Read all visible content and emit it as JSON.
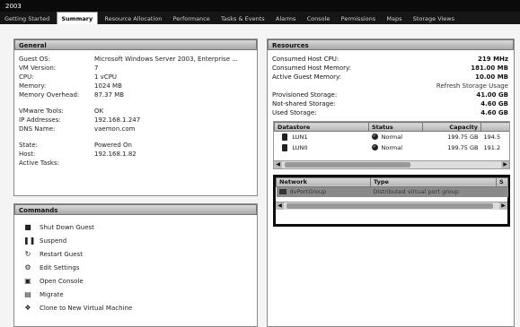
{
  "window": {
    "title": "2003"
  },
  "tabs": [
    {
      "label": "Getting Started",
      "active": false
    },
    {
      "label": "Summary",
      "active": true
    },
    {
      "label": "Resource Allocation",
      "active": false
    },
    {
      "label": "Performance",
      "active": false
    },
    {
      "label": "Tasks & Events",
      "active": false
    },
    {
      "label": "Alarms",
      "active": false
    },
    {
      "label": "Console",
      "active": false
    },
    {
      "label": "Permissions",
      "active": false
    },
    {
      "label": "Maps",
      "active": false
    },
    {
      "label": "Storage Views",
      "active": false
    }
  ],
  "general": {
    "title": "General",
    "rows": [
      {
        "label": "Guest OS:",
        "value": "Microsoft Windows Server 2003, Enterprise ..."
      },
      {
        "label": "VM Version:",
        "value": "7"
      },
      {
        "label": "CPU:",
        "value": "1 vCPU"
      },
      {
        "label": "Memory:",
        "value": "1024 MB"
      },
      {
        "label": "Memory Overhead:",
        "value": "87.37 MB"
      }
    ],
    "rows2": [
      {
        "label": "VMware Tools:",
        "value": "OK"
      },
      {
        "label": "IP Addresses:",
        "value": "192.168.1.247"
      },
      {
        "label": "DNS Name:",
        "value": "vaemon.com"
      }
    ],
    "rows3": [
      {
        "label": "State:",
        "value": "Powered On"
      },
      {
        "label": "Host:",
        "value": "192.168.1.82"
      },
      {
        "label": "Active Tasks:",
        "value": ""
      }
    ]
  },
  "commands": {
    "title": "Commands",
    "items": [
      {
        "label": "Shut Down Guest",
        "icon": "shutdown-icon",
        "glyph": "■"
      },
      {
        "label": "Suspend",
        "icon": "suspend-icon",
        "glyph": "❚❚"
      },
      {
        "label": "Restart Guest",
        "icon": "restart-icon",
        "glyph": "↻"
      },
      {
        "label": "Edit Settings",
        "icon": "settings-icon",
        "glyph": "⚙"
      },
      {
        "label": "Open Console",
        "icon": "console-icon",
        "glyph": "▣"
      },
      {
        "label": "Migrate",
        "icon": "migrate-icon",
        "glyph": "▤"
      },
      {
        "label": "Clone to New Virtual Machine",
        "icon": "clone-icon",
        "glyph": "❖"
      }
    ]
  },
  "resources": {
    "title": "Resources",
    "stats": [
      {
        "label": "Consumed Host CPU:",
        "value": "219 MHz"
      },
      {
        "label": "Consumed Host Memory:",
        "value": "181.00 MB"
      },
      {
        "label": "Active Guest Memory:",
        "value": "10.00 MB"
      }
    ],
    "refresh_label": "Refresh Storage Usage",
    "storage": [
      {
        "label": "Provisioned Storage:",
        "value": "41.00 GB"
      },
      {
        "label": "Not-shared Storage:",
        "value": "4.60 GB"
      },
      {
        "label": "Used Storage:",
        "value": "4.60 GB"
      }
    ],
    "datastore": {
      "columns": [
        "Datastore",
        "Status",
        "Capacity",
        ""
      ],
      "rows": [
        {
          "name": "LUN1",
          "status": "Normal",
          "capacity": "199.75 GB",
          "free": "194.5"
        },
        {
          "name": "LUN0",
          "status": "Normal",
          "capacity": "199.75 GB",
          "free": "191.2"
        }
      ]
    },
    "network": {
      "columns": [
        "Network",
        "Type",
        "S"
      ],
      "rows": [
        {
          "name": "dvPortGroup",
          "type": "Distributed virtual port group"
        }
      ]
    }
  }
}
